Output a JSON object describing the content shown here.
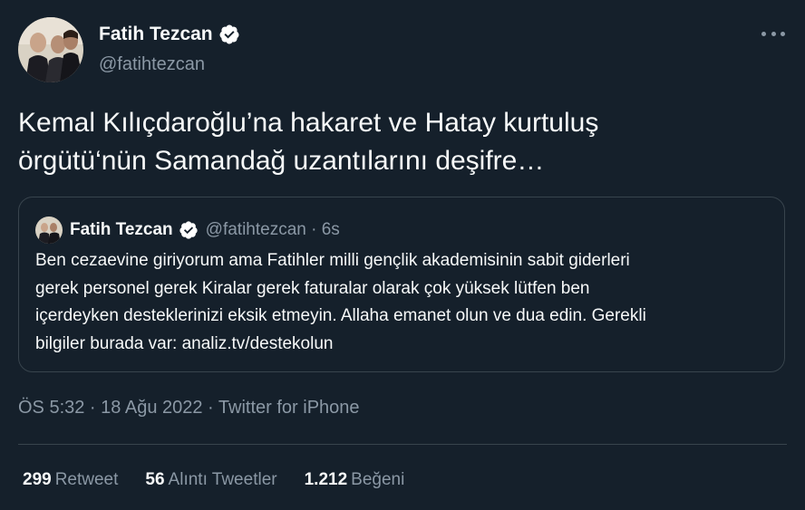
{
  "author": {
    "name": "Fatih Tezcan",
    "handle": "@fatihtezcan"
  },
  "tweet": {
    "text_line1": "Kemal Kılıçdaroğlu’na hakaret ve Hatay kurtuluş",
    "text_line2": "örgütü‘nün Samandağ uzantılarını deşifre…"
  },
  "quoted_tweet": {
    "name": "Fatih Tezcan",
    "handle_time": "@fatihtezcan · 6s",
    "body_lines": [
      "Ben cezaevine giriyorum ama Fatihler milli gençlik akademisinin sabit giderleri",
      "gerek personel gerek Kiralar gerek faturalar olarak çok yüksek lütfen ben",
      "içerdeyken desteklerinizi eksik etmeyin. Allaha emanet olun ve dua edin. Gerekli",
      "bilgiler burada var: analiz.tv/destekolun"
    ]
  },
  "meta": {
    "timestamp": "ÖS 5:32 · 18 Ağu 2022 · Twitter for iPhone"
  },
  "stats": [
    {
      "count": "299",
      "label": "Retweet"
    },
    {
      "count": "56",
      "label": "Alıntı Tweetler"
    },
    {
      "count": "1.212",
      "label": "Beğeni"
    }
  ],
  "colors": {
    "background": "#15202b",
    "verified": "#ffffff",
    "secondary_text": "#8b98a5",
    "border": "#38444d"
  }
}
